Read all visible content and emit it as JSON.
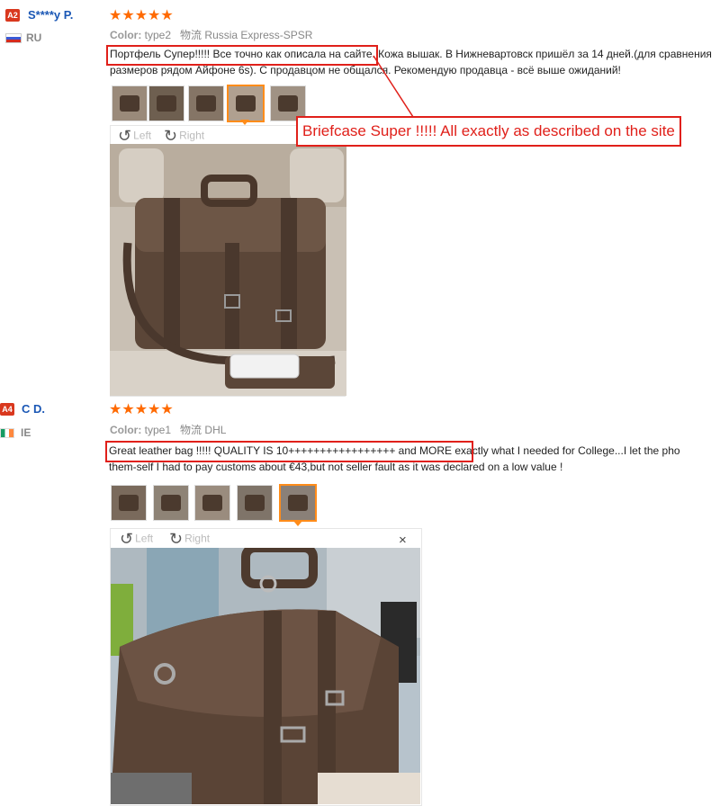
{
  "reviews": [
    {
      "badge": "A2",
      "username": "S****y P.",
      "country": "RU",
      "stars": "★★★★★",
      "color_label": "Color:",
      "color_value": "type2",
      "shipping_label": "物流",
      "shipping_value": "Russia Express-SPSR",
      "text_highlight": "Портфель Супер!!!!! Все точно как описала на сайте.",
      "text_rest": " Кожа вышак. В Нижневартовск пришёл за 14 дней.(для сравнения",
      "text_line2": "размеров рядом Айфоне 6s). С продавцом не общался. Рекомендую продавца - всё выше ожиданий!",
      "viewer": {
        "left": "Left",
        "right": "Right",
        "close": "×"
      },
      "callout": "Briefcase Super !!!!! All exactly as described on the site"
    },
    {
      "badge": "A4",
      "username": "C D.",
      "country": "IE",
      "stars": "★★★★★",
      "color_label": "Color:",
      "color_value": "type1",
      "shipping_label": "物流",
      "shipping_value": "DHL",
      "text_highlight": "Great leather bag !!!!! QUALITY IS 10+++++++++++++++++ and MORE",
      "text_rest": " exactly what I needed for College...I let the pho",
      "text_line2": "them-self I had to pay customs about €43,but not seller fault as it was declared on a low value !",
      "viewer": {
        "left": "Left",
        "right": "Right",
        "close": "×"
      }
    }
  ],
  "colors": {
    "accent_orange": "#ff6a00",
    "annotation_red": "#e0201a",
    "link_blue": "#1a57b5"
  }
}
